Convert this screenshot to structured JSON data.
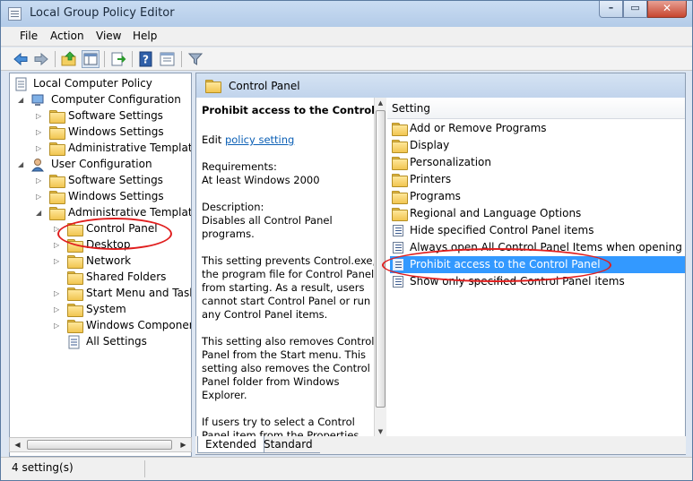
{
  "window": {
    "title": "Local Group Policy Editor"
  },
  "menu": [
    "File",
    "Action",
    "View",
    "Help"
  ],
  "toolbar_icons": [
    "back-arrow-icon",
    "forward-arrow-icon",
    "up-folder-icon",
    "show-hide-tree-icon",
    "export-list-icon",
    "help-icon",
    "properties-icon",
    "filter-icon"
  ],
  "tree": {
    "root": "Local Computer Policy",
    "computer_config": "Computer Configuration",
    "cc_software": "Software Settings",
    "cc_windows": "Windows Settings",
    "cc_admin": "Administrative Templates",
    "user_config": "User Configuration",
    "uc_software": "Software Settings",
    "uc_windows": "Windows Settings",
    "uc_admin": "Administrative Templates",
    "control_panel": "Control Panel",
    "desktop": "Desktop",
    "network": "Network",
    "shared_folders": "Shared Folders",
    "start_menu": "Start Menu and Taskba",
    "system": "System",
    "windows_components": "Windows Component",
    "all_settings": "All Settings"
  },
  "details": {
    "header": "Control Panel",
    "policy_title": "Prohibit access to the Control Panel",
    "edit_prefix": "Edit",
    "edit_link": "policy setting",
    "requirements_label": "Requirements:",
    "requirements_value": "At least Windows 2000",
    "description_label": "Description:",
    "desc_lines": [
      "Disables all Control Panel",
      "programs.",
      "This setting prevents Control.exe,",
      "the program file for Control Panel,",
      "from starting. As a result, users",
      "cannot start Control Panel or run",
      "any Control Panel items.",
      "This setting also removes Control",
      "Panel from the Start menu. This",
      "setting also removes the Control",
      "Panel folder from Windows",
      "Explorer.",
      "If users try to select a Control",
      "Panel item from the Properties"
    ]
  },
  "list": {
    "column": "Setting",
    "items": [
      "Add or Remove Programs",
      "Display",
      "Personalization",
      "Printers",
      "Programs",
      "Regional and Language Options",
      "Hide specified Control Panel items",
      "Always open All Control Panel Items when opening Contro",
      "Prohibit access to the Control Panel",
      "Show only specified Control Panel items"
    ],
    "selected_index": 8
  },
  "tabs": [
    "Extended",
    "Standard"
  ],
  "status": "4 setting(s)",
  "colors": {
    "selection": "#3399ff",
    "annotation": "#e01e1e",
    "link": "#0b5fb5"
  }
}
